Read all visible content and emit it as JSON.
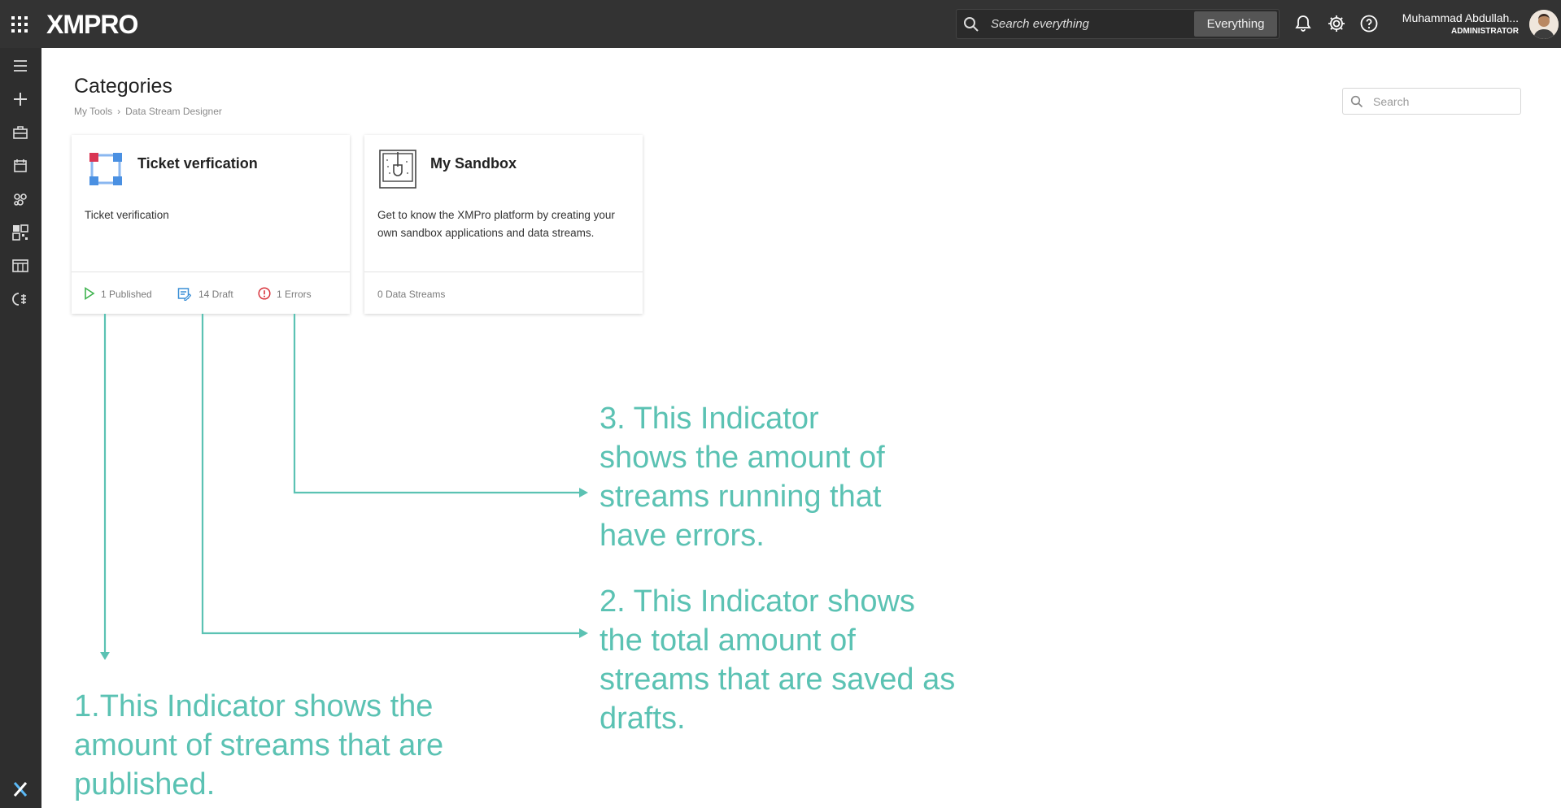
{
  "app": {
    "logo_text": "XMPRO",
    "search_placeholder": "Search everything",
    "search_scope": "Everything",
    "user_name": "Muhammad Abdullah...",
    "user_role": "ADMINISTRATOR"
  },
  "sidebar": {
    "items": [
      "menu-icon",
      "plus-icon",
      "briefcase-icon",
      "calendar-icon",
      "streams-icon",
      "qr-icon",
      "table-icon",
      "ai-icon"
    ]
  },
  "page": {
    "title": "Categories",
    "breadcrumb": [
      "My Tools",
      "Data Stream Designer"
    ],
    "search_placeholder": "Search"
  },
  "cards": [
    {
      "title": "Ticket verfication",
      "description": "Ticket verification",
      "published": "1 Published",
      "draft": "14 Draft",
      "errors": "1 Errors"
    },
    {
      "title": "My Sandbox",
      "description": "Get to know the XMPro platform by creating your own sandbox applications and data streams.",
      "streams": "0 Data Streams"
    }
  ],
  "annotations": {
    "published_1": "1.This Indicator shows the",
    "published_2": "amount of streams that are",
    "published_3": "published.",
    "draft_1": "2. This Indicator shows",
    "draft_2": "the total amount of",
    "draft_3": "streams that are saved as",
    "draft_4": "drafts.",
    "errors_1": "3. This Indicator",
    "errors_2": "shows the amount of",
    "errors_3": "streams running that",
    "errors_4": "have errors.",
    "color": "#5bc2b3"
  },
  "colors": {
    "topbar": "#333333",
    "sidebar": "#2e2e2e",
    "accent": "#5bc2b3",
    "published": "#3fb34f",
    "draft": "#3a8fd6",
    "error": "#d9363e"
  }
}
